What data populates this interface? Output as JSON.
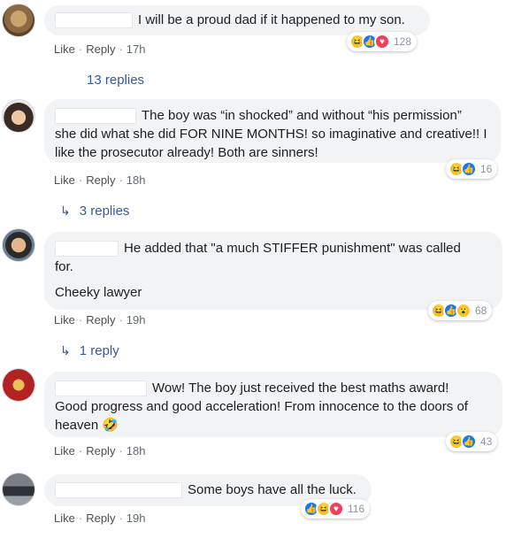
{
  "comments": [
    {
      "text_line1": "I will be a proud dad if it happened to my son.",
      "text_rest": "",
      "reactions": [
        "haha",
        "like",
        "love"
      ],
      "reaction_count": "128",
      "like": "Like",
      "reply": "Reply",
      "time": "17h",
      "replies_label": "13 replies"
    },
    {
      "text_line1": "The boy was “in shocked” and without “his permission”",
      "text_rest": "she did what she did FOR NINE MONTHS! so imaginative and creative!! I like the prosecutor already! Both are sinners!",
      "reactions": [
        "haha",
        "like"
      ],
      "reaction_count": "16",
      "like": "Like",
      "reply": "Reply",
      "time": "18h",
      "replies_label": "3 replies"
    },
    {
      "text_line1": "He added that \"a much STIFFER punishment\" was called",
      "text_rest": "for.",
      "text_extra": "Cheeky lawyer",
      "reactions": [
        "haha",
        "like",
        "wow"
      ],
      "reaction_count": "68",
      "like": "Like",
      "reply": "Reply",
      "time": "19h",
      "replies_label": "1 reply"
    },
    {
      "text_line1": "Wow! The boy just received the best maths award!",
      "text_rest": "Good progress and good acceleration! From innocence to the doors of heaven 🤣",
      "reactions": [
        "haha",
        "like"
      ],
      "reaction_count": "43",
      "like": "Like",
      "reply": "Reply",
      "time": "18h"
    },
    {
      "text_line1": "Some boys have all the luck.",
      "reactions": [
        "like",
        "haha",
        "love"
      ],
      "reaction_count": "116",
      "like": "Like",
      "reply": "Reply",
      "time": "19h"
    }
  ]
}
